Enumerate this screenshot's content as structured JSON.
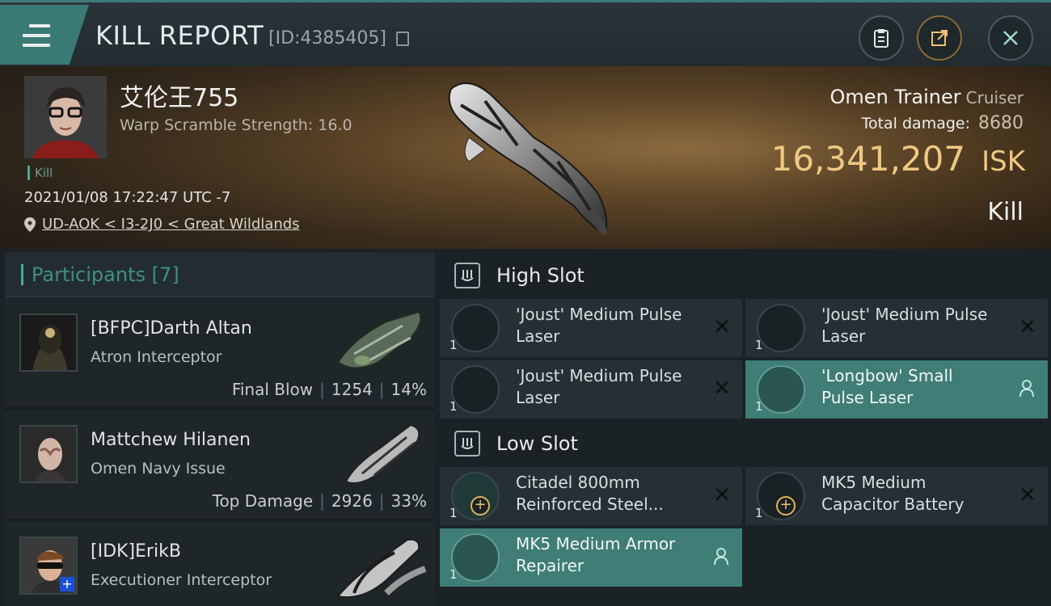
{
  "header": {
    "title": "KILL REPORT",
    "report_id": "[ID:4385405]"
  },
  "victim": {
    "pilot_name": "艾伦王755",
    "warp_scramble": "Warp Scramble Strength: 16.0",
    "tag": "Kill",
    "datetime": "2021/01/08 17:22:47 UTC -7",
    "location": "UD-AOK < I3-2J0 < Great Wildlands",
    "ship_name": "Omen Trainer",
    "ship_class": "Cruiser",
    "total_damage_label": "Total damage:",
    "total_damage_value": "8680",
    "isk_value": "16,341,207",
    "isk_unit": "ISK",
    "result": "Kill"
  },
  "participants": {
    "heading": "Participants [7]",
    "rows": [
      {
        "name": "[BFPC]Darth Altan",
        "ship": "Atron Interceptor",
        "role": "Final Blow",
        "damage": "1254",
        "percent": "14%"
      },
      {
        "name": "Mattchew Hilanen",
        "ship": "Omen Navy Issue",
        "role": "Top Damage",
        "damage": "2926",
        "percent": "33%"
      },
      {
        "name": "[IDK]ErikB",
        "ship": "Executioner Interceptor",
        "role": "",
        "damage": "",
        "percent": ""
      }
    ]
  },
  "slots": {
    "high": {
      "label": "High Slot",
      "modules": [
        {
          "qty": "1",
          "name_line1": "'Joust' Medium Pulse",
          "name_line2": "Laser"
        },
        {
          "qty": "1",
          "name_line1": "'Joust' Medium Pulse",
          "name_line2": "Laser"
        },
        {
          "qty": "1",
          "name_line1": "'Joust' Medium Pulse",
          "name_line2": "Laser"
        },
        {
          "qty": "1",
          "name_line1": "'Longbow' Small",
          "name_line2": "Pulse Laser"
        }
      ]
    },
    "low": {
      "label": "Low Slot",
      "modules": [
        {
          "qty": "1",
          "name_line1": "Citadel 800mm",
          "name_line2": "Reinforced Steel..."
        },
        {
          "qty": "1",
          "name_line1": "MK5 Medium",
          "name_line2": "Capacitor Battery"
        },
        {
          "qty": "1",
          "name_line1": "MK5 Medium Armor",
          "name_line2": "Repairer"
        }
      ]
    }
  },
  "colors": {
    "accent": "#3f7d76",
    "isk": "#efc882",
    "background": "#1b2226"
  }
}
